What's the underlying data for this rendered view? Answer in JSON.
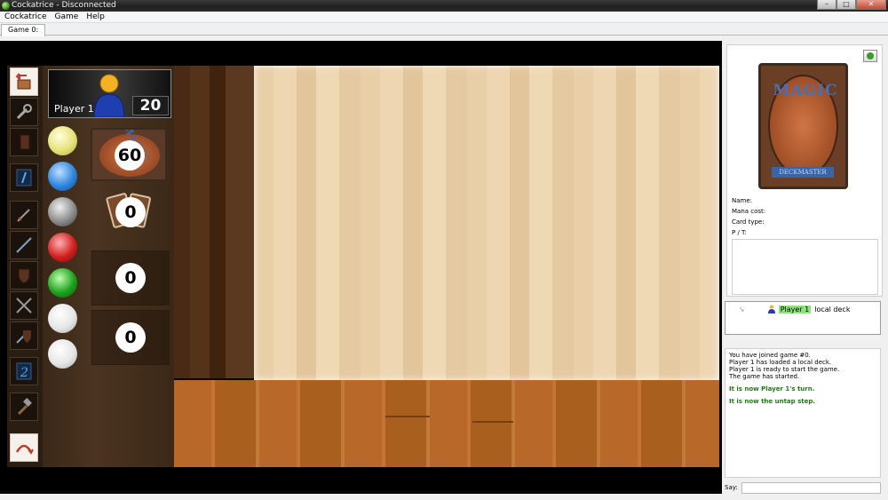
{
  "window": {
    "title": "Cockatrice - Disconnected",
    "buttons": [
      "–",
      "□",
      "✕"
    ]
  },
  "menu": {
    "items": [
      "Cockatrice",
      "Game",
      "Help"
    ]
  },
  "tabs": {
    "items": [
      "Game 0:"
    ]
  },
  "player": {
    "name": "Player 1",
    "life": "20",
    "library_count": "60",
    "hand_count": "0",
    "graveyard_count": "0",
    "exile_count": "0"
  },
  "mana_counters": [
    {
      "color": "white",
      "hex": "#f0ee90"
    },
    {
      "color": "blue",
      "hex": "#2f86df"
    },
    {
      "color": "black",
      "hex": "#8c8c8c"
    },
    {
      "color": "red",
      "hex": "#d21f1f"
    },
    {
      "color": "green",
      "hex": "#1da31d"
    },
    {
      "color": "colorless",
      "hex": "#e6e6e6"
    },
    {
      "color": "storm",
      "hex": "#e6e6e6"
    }
  ],
  "toolbar_icons": [
    "undo-icon",
    "wrench-icon",
    "card-back-icon",
    "untap-icon",
    "sword-icon",
    "lance-icon",
    "shield-icon",
    "crossed-swords-icon",
    "block-icon",
    "upkeep-icon",
    "hammer-icon",
    "end-turn-icon"
  ],
  "card_info": {
    "labels": {
      "name": "Name:",
      "mana_cost": "Mana cost:",
      "card_type": "Card type:",
      "pt": "P / T:"
    },
    "card_logo": "MAGIC",
    "card_subtitle": "DECKMASTER"
  },
  "player_list": {
    "rows": [
      {
        "name": "Player 1",
        "deck": "local deck"
      }
    ]
  },
  "log": {
    "lines": [
      {
        "text": "You have joined game #0.",
        "style": "normal"
      },
      {
        "text": "Player 1 has loaded a local deck.",
        "style": "normal"
      },
      {
        "text": "Player 1 is ready to start the game.",
        "style": "normal"
      },
      {
        "text": "The game has started.",
        "style": "normal"
      },
      {
        "text": "It is now Player 1's turn.",
        "style": "green"
      },
      {
        "text": "It is now the untap step.",
        "style": "green"
      }
    ]
  },
  "say": {
    "label": "Say:",
    "value": ""
  }
}
